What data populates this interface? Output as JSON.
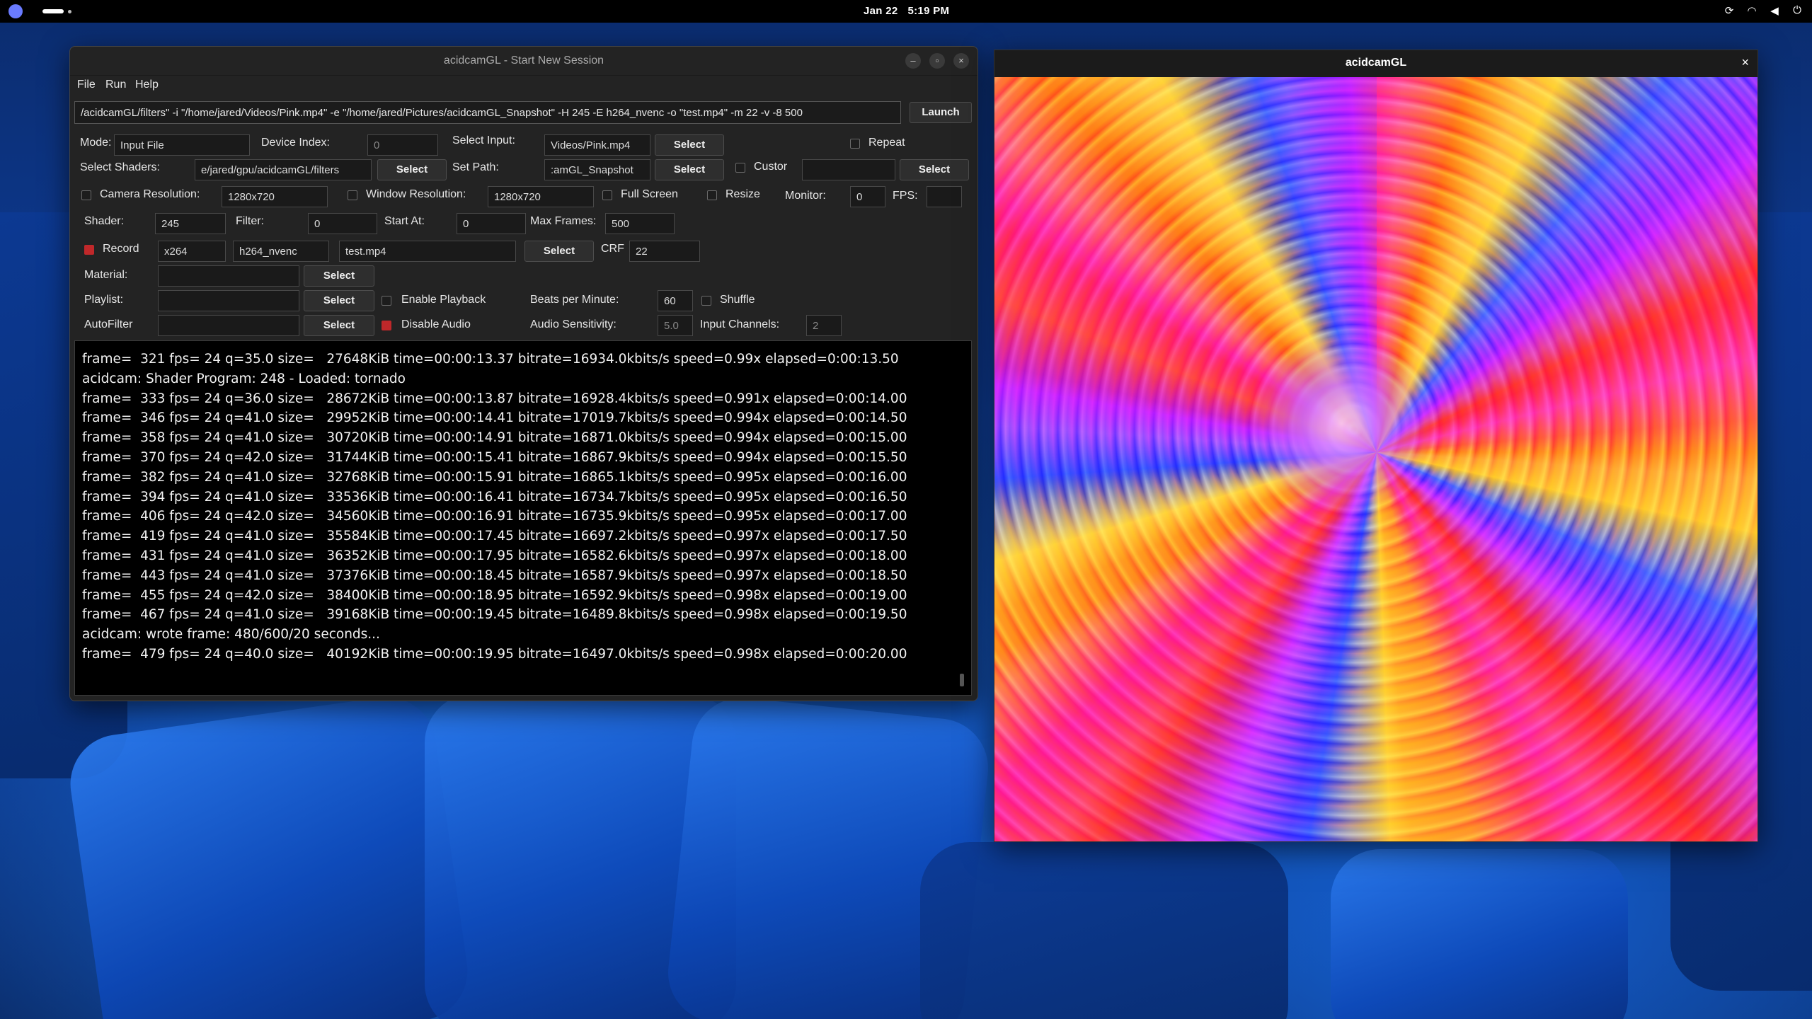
{
  "topbar": {
    "date": "Jan 22",
    "time": "5:19 PM"
  },
  "main_window": {
    "title": "acidcamGL - Start New Session",
    "menu": [
      "File",
      "Run",
      "Help"
    ],
    "command": "/acidcamGL/filters\" -i \"/home/jared/Videos/Pink.mp4\" -e \"/home/jared/Pictures/acidcamGL_Snapshot\" -H 245 -E h264_nvenc -o \"test.mp4\" -m 22 -v -8 500",
    "launch_label": "Launch",
    "labels": {
      "mode": "Mode:",
      "device_index": "Device Index:",
      "select_input": "Select Input:",
      "repeat": "Repeat",
      "select_shaders": "Select Shaders:",
      "set_path": "Set Path:",
      "custom": "Custor",
      "camera_resolution": "Camera Resolution:",
      "window_resolution": "Window Resolution:",
      "full_screen": "Full Screen",
      "resize": "Resize",
      "monitor": "Monitor:",
      "fps": "FPS:",
      "shader": "Shader:",
      "filter": "Filter:",
      "start_at": "Start At:",
      "max_frames": "Max Frames:",
      "record": "Record",
      "crf": "CRF",
      "material": "Material:",
      "playlist": "Playlist:",
      "enable_playback": "Enable Playback",
      "beats_per_minute": "Beats per Minute:",
      "shuffle": "Shuffle",
      "autofilter": "AutoFilter",
      "disable_audio": "Disable Audio",
      "audio_sensitivity": "Audio Sensitivity:",
      "input_channels": "Input Channels:"
    },
    "values": {
      "mode": "Input File",
      "device_index": "0",
      "select_input": "Videos/Pink.mp4",
      "select_shaders": "e/jared/gpu/acidcamGL/filters",
      "set_path": ":amGL_Snapshot",
      "camera_resolution": "1280x720",
      "window_resolution": "1280x720",
      "monitor": "0",
      "shader": "245",
      "filter": "0",
      "start_at": "0",
      "max_frames": "500",
      "codec": "x264",
      "encoder": "h264_nvenc",
      "output_file": "test.mp4",
      "crf": "22",
      "beats_per_minute": "60",
      "audio_sensitivity": "5.0",
      "input_channels": "2"
    },
    "select_label": "Select",
    "console_lines": [
      "frame=  321 fps= 24 q=35.0 size=   27648KiB time=00:00:13.37 bitrate=16934.0kbits/s speed=0.99x elapsed=0:00:13.50",
      "acidcam: Shader Program: 248 - Loaded: tornado",
      "frame=  333 fps= 24 q=36.0 size=   28672KiB time=00:00:13.87 bitrate=16928.4kbits/s speed=0.991x elapsed=0:00:14.00",
      "frame=  346 fps= 24 q=41.0 size=   29952KiB time=00:00:14.41 bitrate=17019.7kbits/s speed=0.994x elapsed=0:00:14.50",
      "frame=  358 fps= 24 q=41.0 size=   30720KiB time=00:00:14.91 bitrate=16871.0kbits/s speed=0.994x elapsed=0:00:15.00",
      "frame=  370 fps= 24 q=42.0 size=   31744KiB time=00:00:15.41 bitrate=16867.9kbits/s speed=0.994x elapsed=0:00:15.50",
      "frame=  382 fps= 24 q=41.0 size=   32768KiB time=00:00:15.91 bitrate=16865.1kbits/s speed=0.995x elapsed=0:00:16.00",
      "frame=  394 fps= 24 q=41.0 size=   33536KiB time=00:00:16.41 bitrate=16734.7kbits/s speed=0.995x elapsed=0:00:16.50",
      "frame=  406 fps= 24 q=42.0 size=   34560KiB time=00:00:16.91 bitrate=16735.9kbits/s speed=0.995x elapsed=0:00:17.00",
      "frame=  419 fps= 24 q=41.0 size=   35584KiB time=00:00:17.45 bitrate=16697.2kbits/s speed=0.997x elapsed=0:00:17.50",
      "frame=  431 fps= 24 q=41.0 size=   36352KiB time=00:00:17.95 bitrate=16582.6kbits/s speed=0.997x elapsed=0:00:18.00",
      "frame=  443 fps= 24 q=41.0 size=   37376KiB time=00:00:18.45 bitrate=16587.9kbits/s speed=0.997x elapsed=0:00:18.50",
      "frame=  455 fps= 24 q=42.0 size=   38400KiB time=00:00:18.95 bitrate=16592.9kbits/s speed=0.998x elapsed=0:00:19.00",
      "frame=  467 fps= 24 q=41.0 size=   39168KiB time=00:00:19.45 bitrate=16489.8kbits/s speed=0.998x elapsed=0:00:19.50",
      "acidcam: wrote frame: 480/600/20 seconds...",
      "frame=  479 fps= 24 q=40.0 size=   40192KiB time=00:00:19.95 bitrate=16497.0kbits/s speed=0.998x elapsed=0:00:20.00"
    ]
  },
  "preview_window": {
    "title": "acidcamGL"
  },
  "colors": {
    "record_checkbox": "#c0282a",
    "disable_audio_checkbox": "#c0282a"
  }
}
